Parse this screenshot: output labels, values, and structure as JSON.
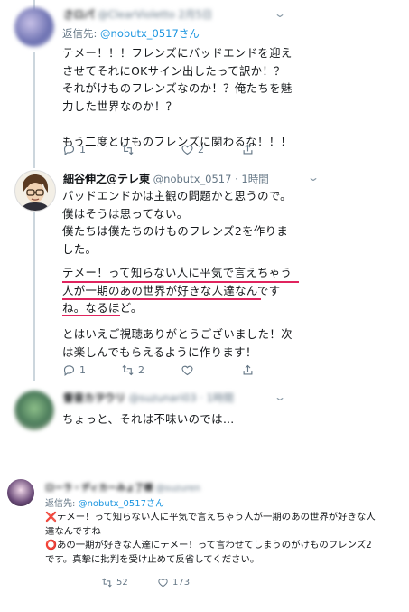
{
  "tweet1": {
    "display_name": "さロパ",
    "handle": "@ClearVioletto 2月5日",
    "reply_prefix": "返信先: ",
    "reply_handle": "@nobutx_0517さん",
    "text": "テメー！！！フレンズにバッドエンドを迎え\nさせてそれにOKサイン出したって訳か！？\nそれがけものフレンズなのか！？俺たちを魅\n力した世界なのか！？\n\nもう二度とけものフレンズに関わるな！！！",
    "replies": "1",
    "retweets": "",
    "likes": "2"
  },
  "tweet2": {
    "display_name": "細谷伸之@テレ東",
    "handle": "@nobutx_0517",
    "time": "· 1時間",
    "text_a": "バッドエンドかは主観の問題かと思うので。\n僕はそうは思ってない。\n僕たちは僕たちのけものフレンズ2を作りま\nした。",
    "text_b": "テメー！って知らない人に平気で言えちゃう\n人が一期のあの世界が好きな人達なんです\nね。なるほど。",
    "text_c": "とはいえご視聴ありがとうございました！次\nは楽しんでもらえるように作ります！",
    "replies": "1",
    "retweets": "2",
    "likes": ""
  },
  "tweet3": {
    "display_name": "督音カヲウリ",
    "handle": "@suzunari03 · 1時間",
    "text": "ちょっと、それは不味いのでは…"
  },
  "tweet4": {
    "display_name": "ローラ・ディカーみょ了様",
    "handle": "@suzuren",
    "reply_prefix": "返信先: ",
    "reply_handle": "@nobutx_0517さん",
    "line1_mark": "❌",
    "line1": "テメー！って知らない人に平気で言えちゃう人が一期のあの世界が好きな人",
    "line2": "達なんですね",
    "line3_mark": "⭕",
    "line3": "あの一期が好きな人達にテメー！って言わせてしまうのがけものフレンズ2",
    "line4": "です。真摯に批判を受け止めて反省してください。",
    "retweets": "52",
    "likes": "173"
  },
  "colors": {
    "link": "#1b95e0",
    "underline": "#e0245e",
    "meta": "#657786",
    "cross": "#e0245e",
    "circle": "#e0245e"
  }
}
